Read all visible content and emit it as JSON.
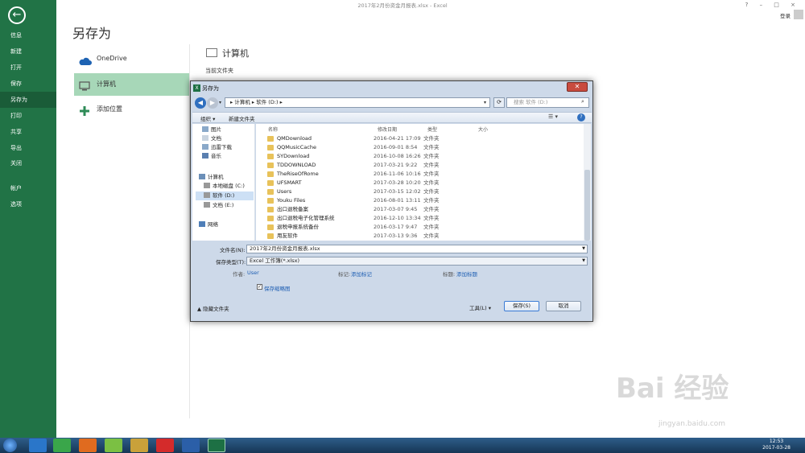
{
  "window": {
    "title": "2017年2月份资金月报表.xlsx - Excel",
    "controls": "? – □ ×",
    "signin": "登录"
  },
  "sidebar": {
    "back": "←",
    "items": [
      {
        "label": "信息"
      },
      {
        "label": "新建"
      },
      {
        "label": "打开"
      },
      {
        "label": "保存"
      },
      {
        "label": "另存为",
        "active": true
      },
      {
        "label": "打印"
      },
      {
        "label": "共享"
      },
      {
        "label": "导出"
      },
      {
        "label": "关闭"
      },
      {
        "label": "帐户"
      },
      {
        "label": "选项"
      }
    ]
  },
  "main": {
    "title": "另存为",
    "locations": [
      {
        "label": "OneDrive"
      },
      {
        "label": "计算机"
      },
      {
        "label": "添加位置"
      }
    ],
    "right_title": "计算机",
    "current_folder": "当前文件夹"
  },
  "dialog": {
    "title": "另存为",
    "close": "✕",
    "address": "▸ 计算机 ▸ 软件 (D:) ▸",
    "search_placeholder": "搜索 软件 (D:)",
    "toolbar": {
      "organize": "组织 ▾",
      "new_folder": "新建文件夹"
    },
    "tree": [
      {
        "label": "图片"
      },
      {
        "label": "文档"
      },
      {
        "label": "迅雷下载"
      },
      {
        "label": "音乐"
      },
      {
        "label": "计算机"
      },
      {
        "label": "本地磁盘 (C:)"
      },
      {
        "label": "软件 (D:)"
      },
      {
        "label": "文档 (E:)"
      },
      {
        "label": "网络"
      }
    ],
    "columns": {
      "name": "名称",
      "modified": "修改日期",
      "type": "类型",
      "size": "大小"
    },
    "files": [
      {
        "name": "QMDownload",
        "date": "2016-04-21 17:09",
        "type": "文件夹"
      },
      {
        "name": "QQMusicCache",
        "date": "2016-09-01 8:54",
        "type": "文件夹"
      },
      {
        "name": "SYDownload",
        "date": "2016-10-08 16:26",
        "type": "文件夹"
      },
      {
        "name": "TDDOWNLOAD",
        "date": "2017-03-21 9:22",
        "type": "文件夹"
      },
      {
        "name": "TheRiseOfRome",
        "date": "2016-11-06 10:16",
        "type": "文件夹"
      },
      {
        "name": "UFSMART",
        "date": "2017-03-28 10:20",
        "type": "文件夹"
      },
      {
        "name": "Users",
        "date": "2017-03-15 12:02",
        "type": "文件夹"
      },
      {
        "name": "Youku Files",
        "date": "2016-08-01 13:11",
        "type": "文件夹"
      },
      {
        "name": "出口退税备案",
        "date": "2017-03-07 9:45",
        "type": "文件夹"
      },
      {
        "name": "出口退税电子化管理系统",
        "date": "2016-12-10 13:34",
        "type": "文件夹"
      },
      {
        "name": "退税申报系统备份",
        "date": "2016-03-17 9:47",
        "type": "文件夹"
      },
      {
        "name": "用友软件",
        "date": "2017-03-13 9:36",
        "type": "文件夹"
      }
    ],
    "filename_label": "文件名(N):",
    "filename": "2017年2月份资金月报表.xlsx",
    "filetype_label": "保存类型(T):",
    "filetype": "Excel 工作簿(*.xlsx)",
    "author_label": "作者:",
    "author": "User",
    "tags_label": "标记:",
    "tags": "添加标记",
    "title_label": "标题:",
    "title_value": "添加标题",
    "thumbnail": "保存缩略图",
    "hide_folders": "隐藏文件夹",
    "tools": "工具(L) ▾",
    "save": "保存(S)",
    "cancel": "取消"
  },
  "taskbar": {
    "time": "12:53",
    "date": "2017-03-28"
  },
  "watermark": {
    "brand": "Bai 经验",
    "url": "jingyan.baidu.com"
  }
}
